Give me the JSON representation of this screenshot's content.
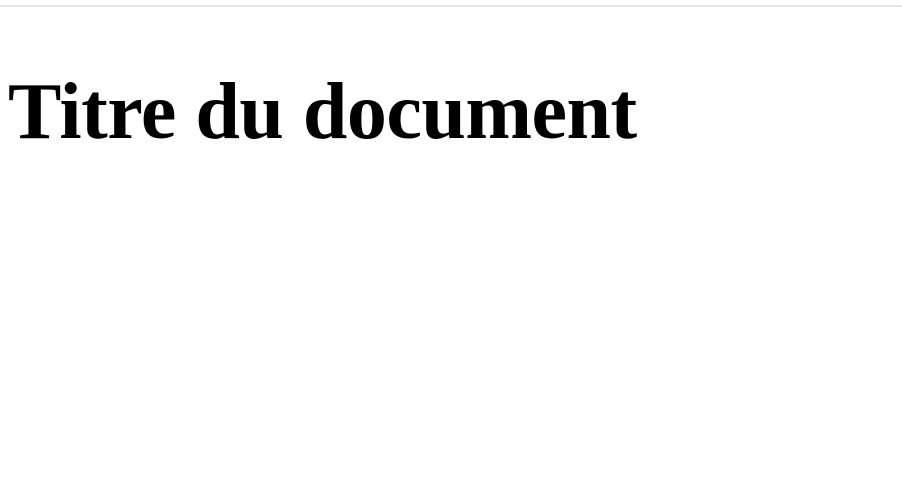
{
  "document": {
    "title": "Titre du document"
  },
  "colors": {
    "background": "#ffffff",
    "text": "#000000",
    "top_rule": "#e3e3e3"
  }
}
